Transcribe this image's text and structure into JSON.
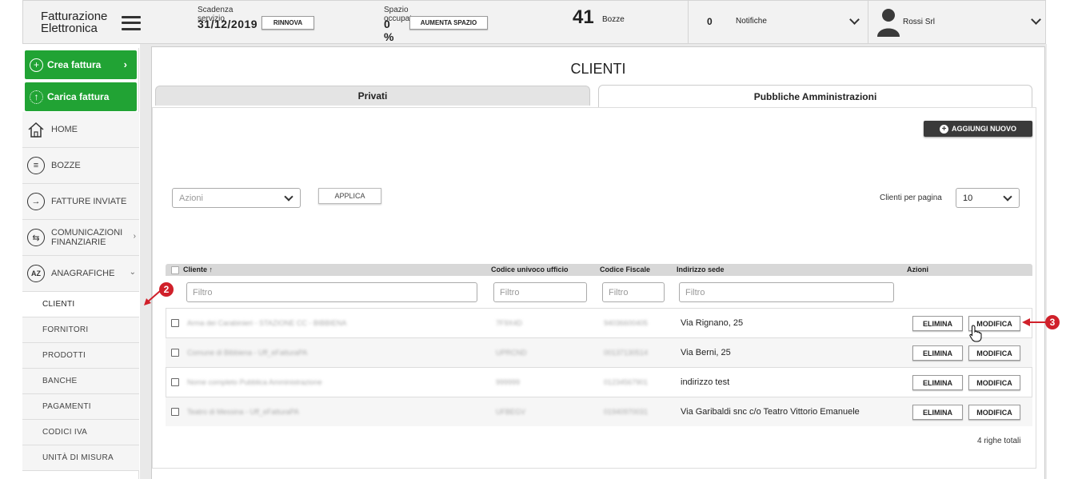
{
  "topbar": {
    "brand_line1": "Fatturazione",
    "brand_line2": "Elettronica",
    "scadenza_label": "Scadenza servizio",
    "scadenza_value": "31/12/2019",
    "rinnova_label": "RINNOVA",
    "spazio_label": "Spazio occupato",
    "spazio_value": "0 %",
    "aumenta_label": "AUMENTA SPAZIO",
    "bozze_count": "41",
    "bozze_label": "Bozze",
    "notifiche_count": "0",
    "notifiche_label": "Notifiche",
    "user_name": "Rossi Srl"
  },
  "sidebar": {
    "crea_label": "Crea fattura",
    "carica_label": "Carica fattura",
    "items": [
      {
        "label": "HOME",
        "icon": "home-icon"
      },
      {
        "label": "BOZZE",
        "icon": "drafts-icon"
      },
      {
        "label": "FATTURE INVIATE",
        "icon": "arrow-right-circle-icon"
      },
      {
        "label": "COMUNICAZIONI FINANZIARIE",
        "icon": "exchange-icon"
      },
      {
        "label": "ANAGRAFICHE",
        "icon": "az-icon"
      }
    ],
    "subitems": [
      "CLIENTI",
      "FORNITORI",
      "PRODOTTI",
      "BANCHE",
      "PAGAMENTI",
      "CODICI IVA",
      "UNITÀ DI MISURA"
    ]
  },
  "main": {
    "title": "CLIENTI",
    "tabs": [
      "Privati",
      "Pubbliche Amministrazioni"
    ],
    "add_label": "AGGIUNGI NUOVO",
    "azioni_placeholder": "Azioni",
    "applica_label": "APPLICA",
    "perpage_label": "Clienti per pagina",
    "perpage_value": "10",
    "columns": [
      "Cliente",
      "Codice univoco ufficio",
      "Codice Fiscale",
      "Indirizzo sede",
      "Azioni"
    ],
    "sort_indicator": "↑",
    "filter_placeholder": "Filtro",
    "rows": [
      {
        "cliente": "Arma dei Carabinieri - STAZIONE CC - BIBBIENA",
        "codice": "7F9X4D",
        "cf": "94036600405",
        "indirizzo": "Via Rignano, 25"
      },
      {
        "cliente": "Comune di Bibbiena - Uff_eFatturaPA",
        "codice": "UPRCND",
        "cf": "00137130514",
        "indirizzo": "Via Berni, 25"
      },
      {
        "cliente": "Nome completo Pubblica Amministrazione",
        "codice": "999999",
        "cf": "01234567901",
        "indirizzo": "indirizzo test"
      },
      {
        "cliente": "Teatro di Messina - Uff_eFatturaPA",
        "codice": "UFBEGV",
        "cf": "01940970031",
        "indirizzo": "Via Garibaldi snc c/o Teatro Vittorio Emanuele"
      }
    ],
    "elimina_label": "ELIMINA",
    "modifica_label": "MODIFICA",
    "rows_total": "4 righe totali"
  },
  "annotations": {
    "badge2": "2",
    "badge3": "3",
    "color": "#d0202a"
  }
}
